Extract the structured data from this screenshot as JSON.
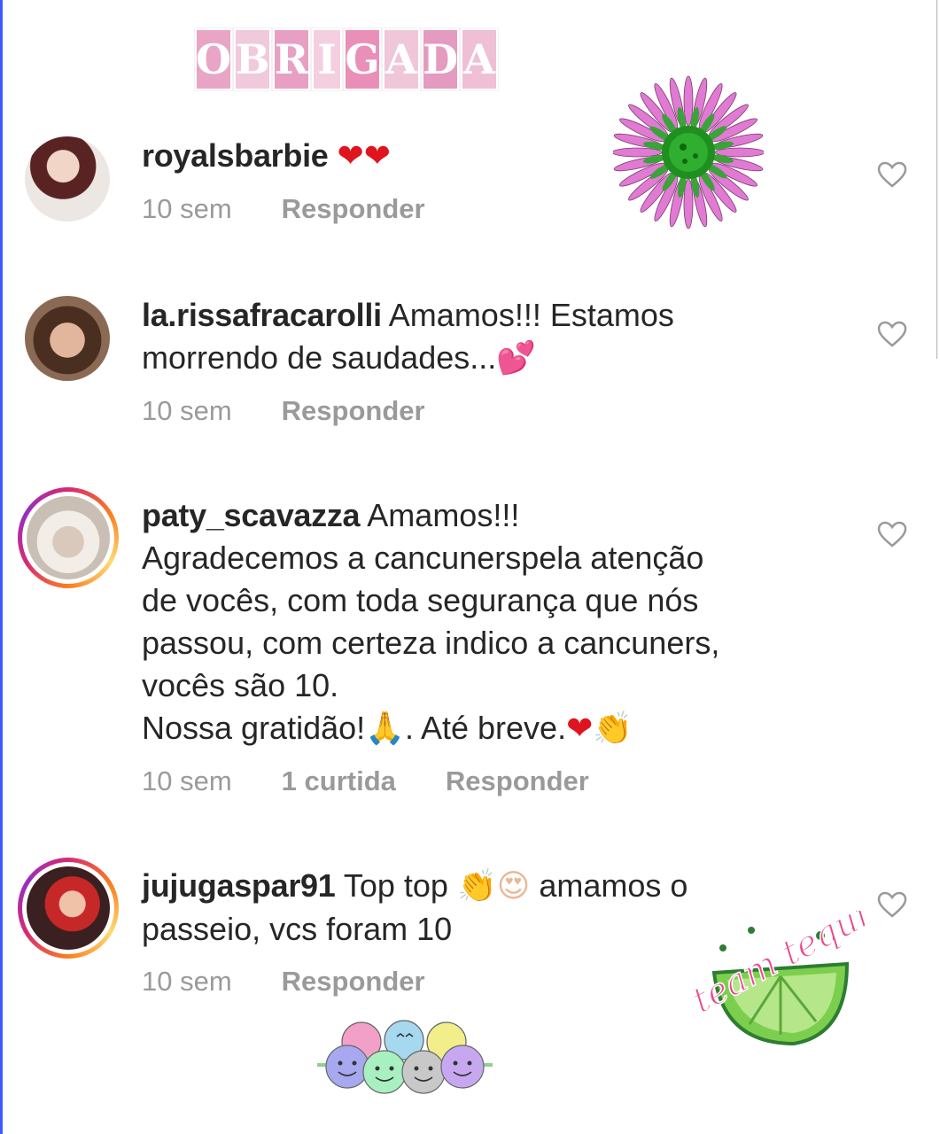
{
  "sticker_title": {
    "letters": [
      "O",
      "B",
      "R",
      "I",
      "G",
      "A",
      "D",
      "A"
    ],
    "colors": [
      "#e8a5c5",
      "#f1c9dc",
      "#e7a0c3",
      "#f4cfe0",
      "#ea8fb8",
      "#f0c6d9",
      "#e59ac0",
      "#efbfd6"
    ]
  },
  "comments": [
    {
      "username": "royalsbarbie",
      "body": "",
      "emoji": "❤❤",
      "time": "10 sem",
      "likes": "",
      "reply": "Responder",
      "avatar_colors": [
        "#6b2b2b",
        "#e7d0c4"
      ],
      "story_ring": false
    },
    {
      "username": "la.rissafracarolli",
      "body_lines": [
        "Amamos!!! Estamos",
        "morrendo de saudades..."
      ],
      "emoji": "💕",
      "time": "10 sem",
      "likes": "",
      "reply": "Responder",
      "avatar_colors": [
        "#5a3b2a",
        "#d9b8a0"
      ],
      "story_ring": false
    },
    {
      "username": "paty_scavazza",
      "body_lines": [
        "Amamos!!!",
        "Agradecemos a cancunerspela atenção",
        "de vocês, com toda segurança que nós",
        "passou, com certeza indico a cancuners,",
        "vocês são 10.",
        "Nossa gratidão!",
        ". Até breve."
      ],
      "emoji_pray": "🙏",
      "emoji_end": "❤👏",
      "time": "10 sem",
      "likes": "1 curtida",
      "reply": "Responder",
      "avatar_colors": [
        "#e8e2da",
        "#cfc6bc"
      ],
      "story_ring": true
    },
    {
      "username": "jujugaspar91",
      "body_lines": [
        "Top top",
        "amamos o",
        "passeio, vcs foram 10"
      ],
      "emoji_mid": "👏😍",
      "time": "10 sem",
      "likes": "",
      "reply": "Responder",
      "avatar_colors": [
        "#c62828",
        "#f3c7b0"
      ],
      "story_ring": true
    }
  ],
  "icons": {
    "like": "heart-outline-icon"
  },
  "stickers": {
    "tequila": "team tequila"
  }
}
